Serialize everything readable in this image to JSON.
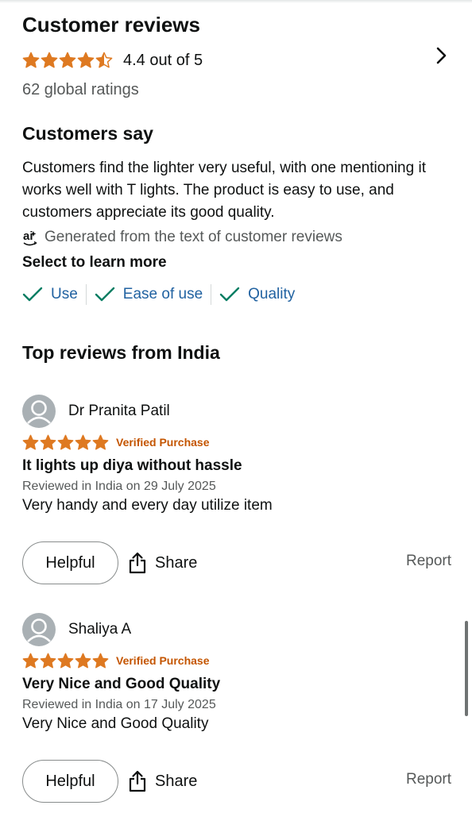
{
  "reviews_section": {
    "title": "Customer reviews",
    "rating": 4.4,
    "rating_text": "4.4 out of 5",
    "global_ratings": "62 global ratings",
    "chevron_icon": "chevron-right-icon"
  },
  "customers_say": {
    "title": "Customers say",
    "summary": "Customers find the lighter very useful, with one mentioning it works well with T lights. The product is easy to use, and customers appreciate its good quality.",
    "generated_note": "Generated from the text of customer reviews",
    "ai_icon": "ai-icon",
    "select_label": "Select to learn more",
    "aspects": [
      {
        "label": "Use",
        "icon": "checkmark-icon"
      },
      {
        "label": "Ease of use",
        "icon": "checkmark-icon"
      },
      {
        "label": "Quality",
        "icon": "checkmark-icon"
      }
    ]
  },
  "top_reviews": {
    "title": "Top reviews from India",
    "items": [
      {
        "author": "Dr Pranita Patil",
        "stars": 5,
        "badge": "Verified Purchase",
        "title": "It lights up diya without hassle",
        "date": "Reviewed in India on 29 July 2025",
        "body": "Very handy and every day utilize item",
        "helpful_label": "Helpful",
        "share_label": "Share",
        "report_label": "Report"
      },
      {
        "author": "Shaliya A",
        "stars": 5,
        "badge": "Verified Purchase",
        "title": "Very Nice and Good Quality",
        "date": "Reviewed in India on 17 July 2025",
        "body": "Very Nice and Good Quality",
        "helpful_label": "Helpful",
        "share_label": "Share",
        "report_label": "Report"
      }
    ]
  },
  "colors": {
    "star": "#de7921",
    "link": "#2162a1",
    "check": "#067d62",
    "verified": "#c45500",
    "muted": "#565959"
  }
}
